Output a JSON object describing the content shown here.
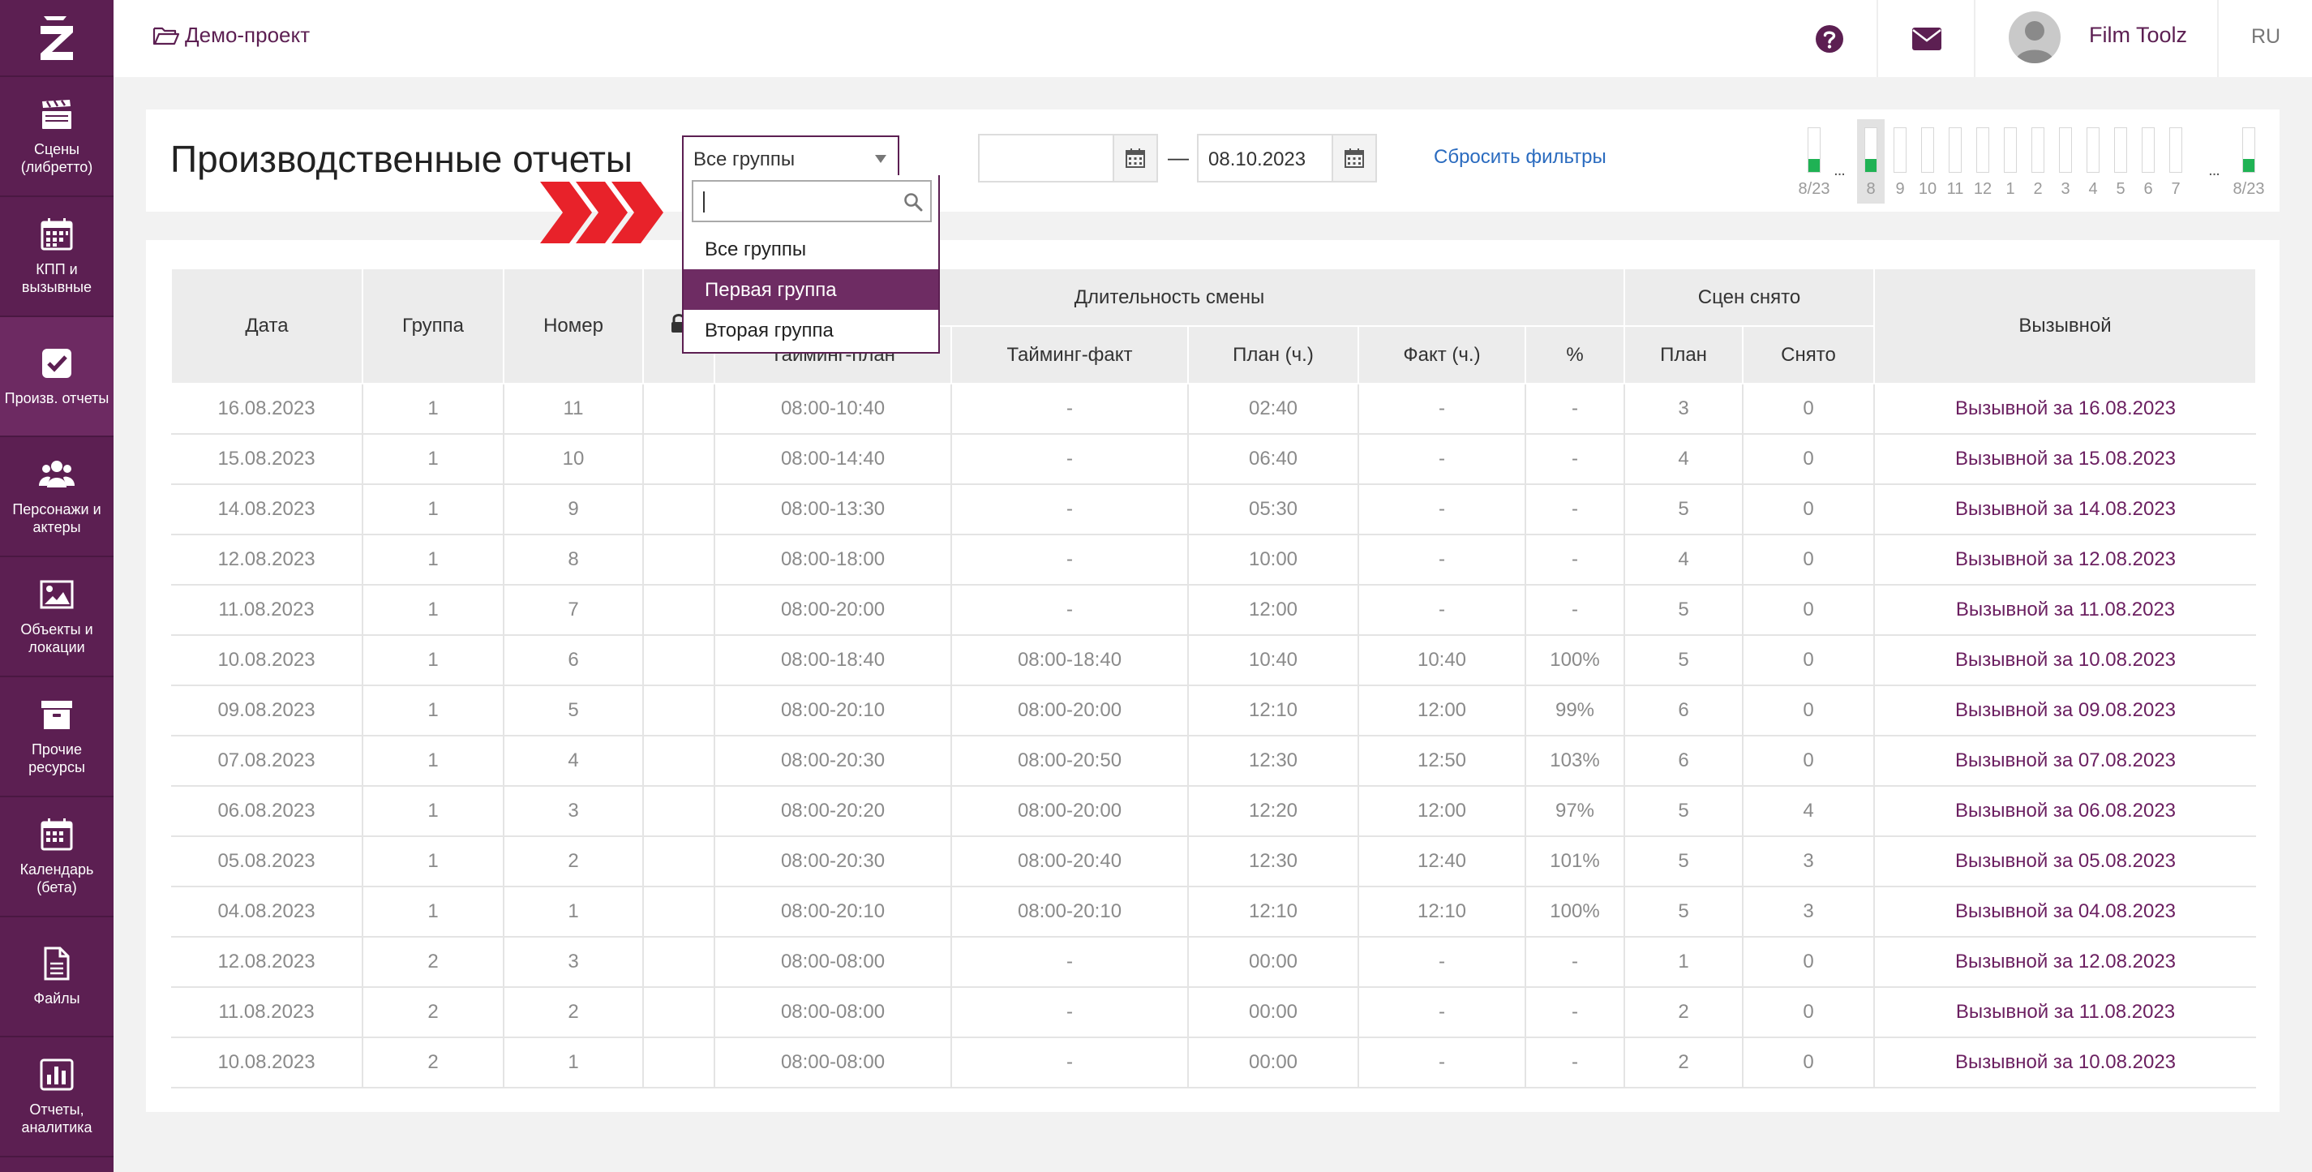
{
  "sidebar": {
    "items": [
      {
        "label": "Сцены\n(либретто)",
        "icon": "clapperboard-icon"
      },
      {
        "label": "КПП и\nвызывные",
        "icon": "calendar-grid-icon"
      },
      {
        "label": "Произв. отчеты",
        "icon": "checkbox-icon"
      },
      {
        "label": "Персонажи и\nактеры",
        "icon": "people-icon"
      },
      {
        "label": "Объекты и\nлокации",
        "icon": "image-icon"
      },
      {
        "label": "Прочие\nресурсы",
        "icon": "archive-box-icon"
      },
      {
        "label": "Календарь\n(бета)",
        "icon": "calendar-icon"
      },
      {
        "label": "Файлы",
        "icon": "file-icon"
      },
      {
        "label": "Отчеты,\nаналитика",
        "icon": "bar-chart-icon"
      }
    ]
  },
  "topbar": {
    "project": "Демо-проект",
    "user": "Film Toolz",
    "lang": "RU"
  },
  "header": {
    "title": "Производственные отчеты",
    "group_value": "Все группы",
    "date_from": "",
    "date_dash": "—",
    "date_to": "08.10.2023",
    "reset": "Сбросить фильтры"
  },
  "mini": {
    "labels": [
      "8/23",
      "8",
      "9",
      "10",
      "11",
      "12",
      "1",
      "2",
      "3",
      "4",
      "5",
      "6",
      "7",
      "8/23"
    ],
    "dots": "...",
    "filled": [
      true,
      true,
      false,
      false,
      false,
      false,
      false,
      false,
      false,
      false,
      false,
      false,
      false,
      true
    ],
    "selected_index": 1,
    "fill_color": "#1fb254"
  },
  "dropdown": {
    "options": [
      "Все группы",
      "Первая группа",
      "Вторая группа"
    ],
    "highlighted": 1,
    "highlight_color": "#6e2c63"
  },
  "table": {
    "headers": {
      "date": "Дата",
      "group": "Группа",
      "number": "Номер",
      "shift_duration": "Длительность смены",
      "timing_plan": "Тайминг-план",
      "timing_fact": "Тайминг-факт",
      "plan_h": "План (ч.)",
      "fact_h": "Факт (ч.)",
      "percent": "%",
      "scenes_shot": "Сцен снято",
      "scenes_plan": "План",
      "scenes_done": "Снято",
      "callsheet": "Вызывной"
    },
    "rows": [
      {
        "date": "16.08.2023",
        "group": "1",
        "num": "11",
        "tplan": "08:00-10:40",
        "tfact": "-",
        "planh": "02:40",
        "facth": "-",
        "pct": "-",
        "splan": "3",
        "sdone": "0",
        "call": "Вызывной за 16.08.2023"
      },
      {
        "date": "15.08.2023",
        "group": "1",
        "num": "10",
        "tplan": "08:00-14:40",
        "tfact": "-",
        "planh": "06:40",
        "facth": "-",
        "pct": "-",
        "splan": "4",
        "sdone": "0",
        "call": "Вызывной за 15.08.2023"
      },
      {
        "date": "14.08.2023",
        "group": "1",
        "num": "9",
        "tplan": "08:00-13:30",
        "tfact": "-",
        "planh": "05:30",
        "facth": "-",
        "pct": "-",
        "splan": "5",
        "sdone": "0",
        "call": "Вызывной за 14.08.2023"
      },
      {
        "date": "12.08.2023",
        "group": "1",
        "num": "8",
        "tplan": "08:00-18:00",
        "tfact": "-",
        "planh": "10:00",
        "facth": "-",
        "pct": "-",
        "splan": "4",
        "sdone": "0",
        "call": "Вызывной за 12.08.2023"
      },
      {
        "date": "11.08.2023",
        "group": "1",
        "num": "7",
        "tplan": "08:00-20:00",
        "tfact": "-",
        "planh": "12:00",
        "facth": "-",
        "pct": "-",
        "splan": "5",
        "sdone": "0",
        "call": "Вызывной за 11.08.2023"
      },
      {
        "date": "10.08.2023",
        "group": "1",
        "num": "6",
        "tplan": "08:00-18:40",
        "tfact": "08:00-18:40",
        "planh": "10:40",
        "facth": "10:40",
        "pct": "100%",
        "splan": "5",
        "sdone": "0",
        "call": "Вызывной за 10.08.2023"
      },
      {
        "date": "09.08.2023",
        "group": "1",
        "num": "5",
        "tplan": "08:00-20:10",
        "tfact": "08:00-20:00",
        "planh": "12:10",
        "facth": "12:00",
        "pct": "99%",
        "splan": "6",
        "sdone": "0",
        "call": "Вызывной за 09.08.2023"
      },
      {
        "date": "07.08.2023",
        "group": "1",
        "num": "4",
        "tplan": "08:00-20:30",
        "tfact": "08:00-20:50",
        "planh": "12:30",
        "facth": "12:50",
        "pct": "103%",
        "splan": "6",
        "sdone": "0",
        "call": "Вызывной за 07.08.2023"
      },
      {
        "date": "06.08.2023",
        "group": "1",
        "num": "3",
        "tplan": "08:00-20:20",
        "tfact": "08:00-20:00",
        "planh": "12:20",
        "facth": "12:00",
        "pct": "97%",
        "splan": "5",
        "sdone": "4",
        "call": "Вызывной за 06.08.2023"
      },
      {
        "date": "05.08.2023",
        "group": "1",
        "num": "2",
        "tplan": "08:00-20:30",
        "tfact": "08:00-20:40",
        "planh": "12:30",
        "facth": "12:40",
        "pct": "101%",
        "splan": "5",
        "sdone": "3",
        "call": "Вызывной за 05.08.2023"
      },
      {
        "date": "04.08.2023",
        "group": "1",
        "num": "1",
        "tplan": "08:00-20:10",
        "tfact": "08:00-20:10",
        "planh": "12:10",
        "facth": "12:10",
        "pct": "100%",
        "splan": "5",
        "sdone": "3",
        "call": "Вызывной за 04.08.2023"
      },
      {
        "date": "12.08.2023",
        "group": "2",
        "num": "3",
        "tplan": "08:00-08:00",
        "tfact": "-",
        "planh": "00:00",
        "facth": "-",
        "pct": "-",
        "splan": "1",
        "sdone": "0",
        "call": "Вызывной за 12.08.2023"
      },
      {
        "date": "11.08.2023",
        "group": "2",
        "num": "2",
        "tplan": "08:00-08:00",
        "tfact": "-",
        "planh": "00:00",
        "facth": "-",
        "pct": "-",
        "splan": "2",
        "sdone": "0",
        "call": "Вызывной за 11.08.2023"
      },
      {
        "date": "10.08.2023",
        "group": "2",
        "num": "1",
        "tplan": "08:00-08:00",
        "tfact": "-",
        "planh": "00:00",
        "facth": "-",
        "pct": "-",
        "splan": "2",
        "sdone": "0",
        "call": "Вызывной за 10.08.2023"
      }
    ]
  },
  "colors": {
    "brand": "#5c1f52",
    "link": "#2a6bbf",
    "callsheet_link": "#6b1f60"
  }
}
